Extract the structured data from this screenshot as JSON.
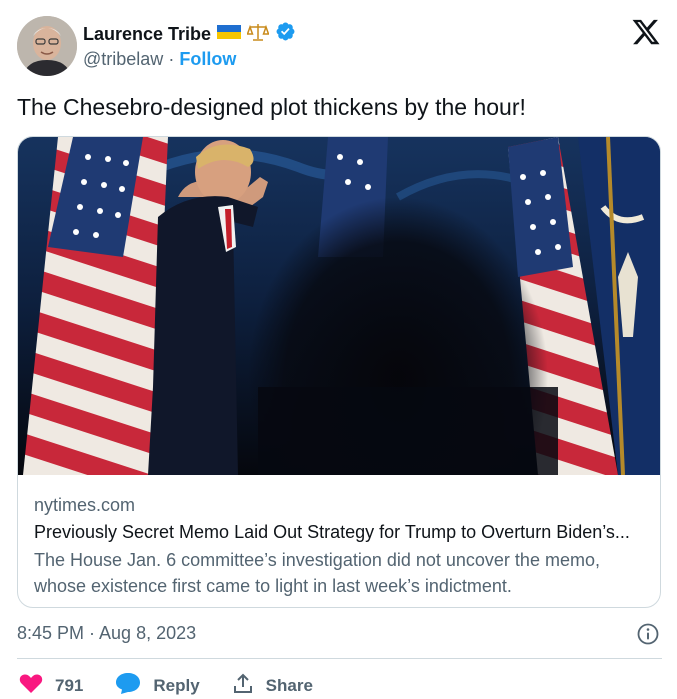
{
  "author": {
    "display_name": "Laurence Tribe",
    "handle": "@tribelaw",
    "separator": "·",
    "follow_label": "Follow",
    "badges": [
      "ukraine-flag-icon",
      "scales-icon",
      "verified-badge-icon"
    ]
  },
  "tweet": {
    "text": "The Chesebro-designed plot thickens by the hour!",
    "timestamp": "8:45 PM · Aug 8, 2023"
  },
  "card": {
    "domain": "nytimes.com",
    "title": "Previously Secret Memo Laid Out Strategy for Trump to Overturn Biden’s...",
    "description": "The House Jan. 6 committee’s investigation did not uncover the memo, whose existence first came to light in last week’s indictment."
  },
  "actions": {
    "like_count": "791",
    "reply_label": "Reply",
    "share_label": "Share"
  },
  "colors": {
    "accent": "#1d9bf0",
    "like": "#f91880",
    "muted": "#536471",
    "text": "#0f1419",
    "border": "#cfd9de"
  }
}
